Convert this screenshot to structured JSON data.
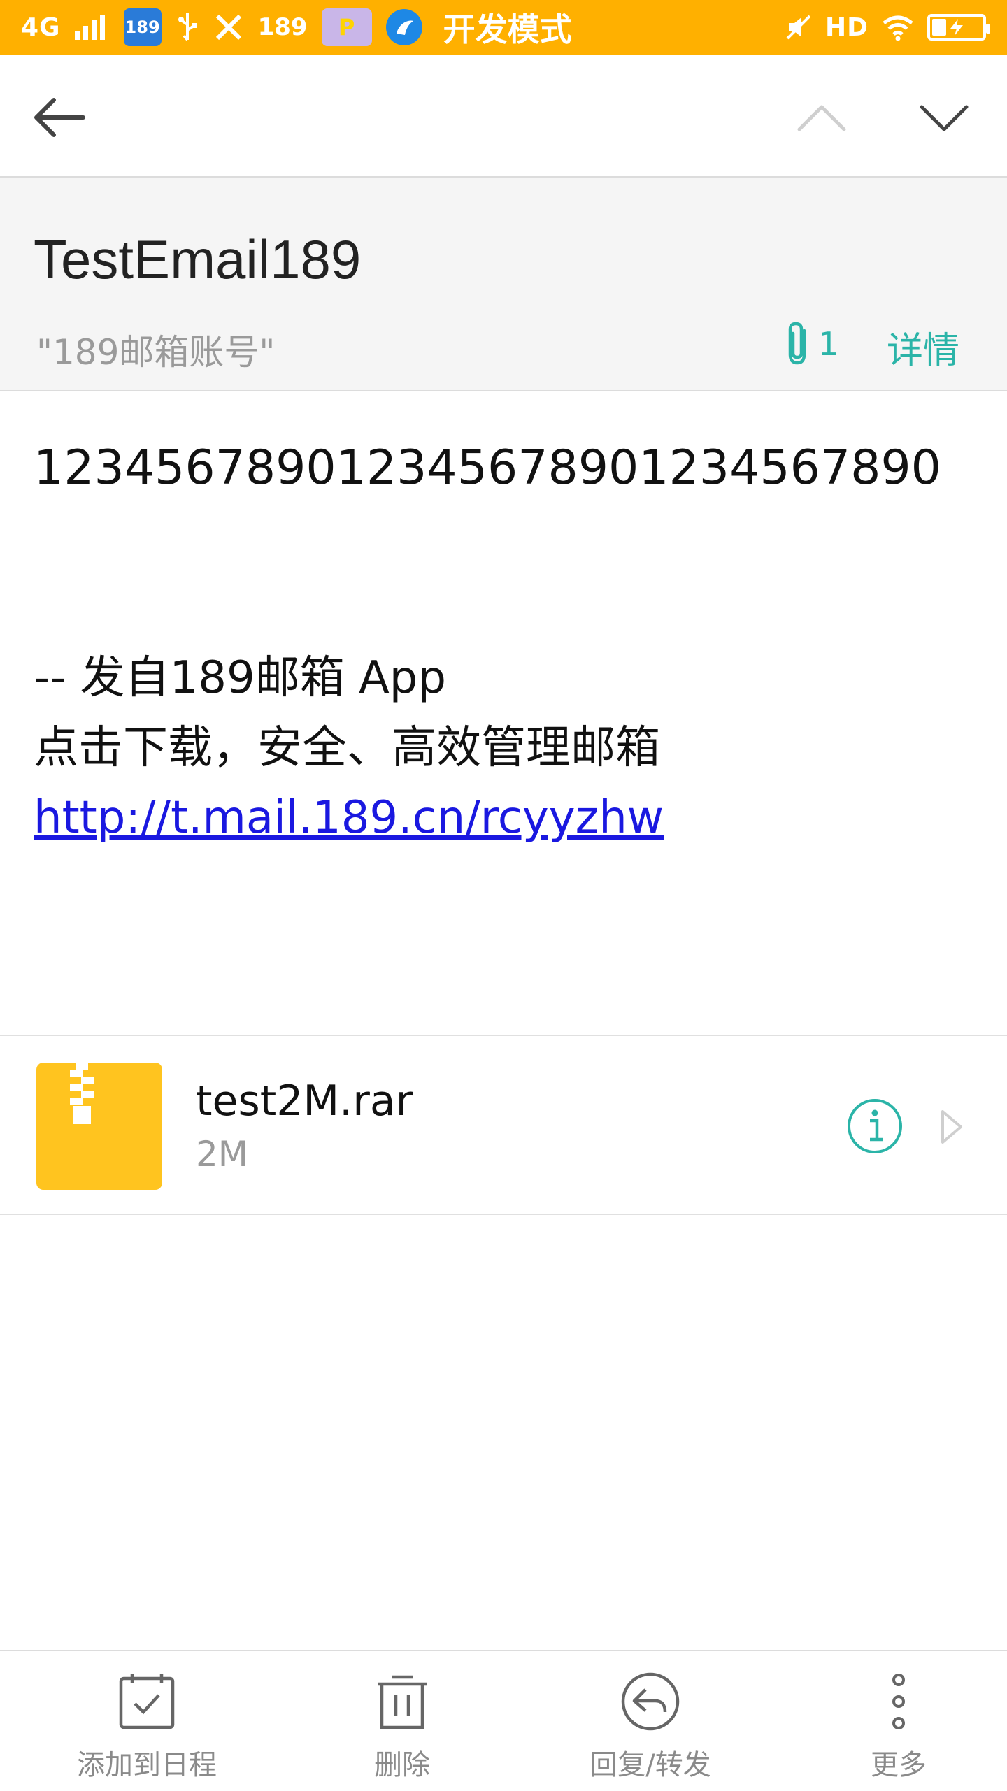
{
  "status_bar": {
    "network": "4G",
    "app_badge_1": "189",
    "text_189": "189",
    "p_badge": "P",
    "mode_label": "开发模式",
    "hd_label": "HD"
  },
  "nav": {
    "back_icon": "arrow-left-icon",
    "prev_icon": "chevron-up-icon",
    "next_icon": "chevron-down-icon"
  },
  "header": {
    "subject": "TestEmail189",
    "sender": "\"189邮箱账号\"",
    "attachment_count": "1",
    "details_label": "详情",
    "accent_color": "#2BB4A8"
  },
  "body": {
    "main_text": "123456789012345678901234567890",
    "signature_line1": "-- 发自189邮箱 App",
    "signature_line2": "点击下载，安全、高效管理邮箱",
    "link": "http://t.mail.189.cn/rcyyzhw"
  },
  "attachment": {
    "file_name": "test2M.rar",
    "file_size": "2M",
    "icon": "zip-file-icon",
    "thumb_color": "#FFC41F"
  },
  "toolbar": {
    "items": [
      {
        "label": "添加到日程",
        "icon": "calendar-check-icon"
      },
      {
        "label": "删除",
        "icon": "trash-icon"
      },
      {
        "label": "回复/转发",
        "icon": "reply-icon"
      },
      {
        "label": "更多",
        "icon": "more-vertical-icon"
      }
    ]
  },
  "colors": {
    "status_bar": "#FFB000",
    "link": "#1A18E0",
    "header_bg": "#F5F5F5"
  }
}
